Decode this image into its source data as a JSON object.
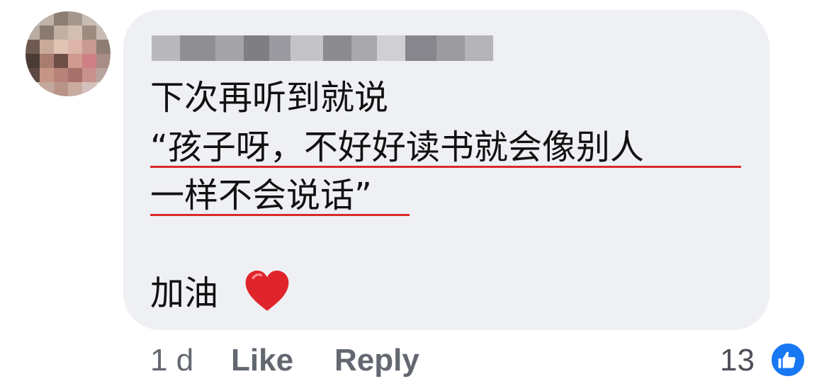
{
  "comment": {
    "author_name": "",
    "lines": [
      "下次再听到就说",
      "“孩子呀，不好好读书就会像别人",
      "一样不会说话”",
      "加油"
    ],
    "emoji": "heart-emoji"
  },
  "footer": {
    "time": "1 d",
    "like_label": "Like",
    "reply_label": "Reply",
    "reaction_count": "13",
    "reaction_icon": "thumbs-up-icon"
  },
  "colors": {
    "bubble": "#eff0f4",
    "underline": "#d92b2b",
    "like_blue": "#1877f2",
    "meta_text": "#636770"
  }
}
